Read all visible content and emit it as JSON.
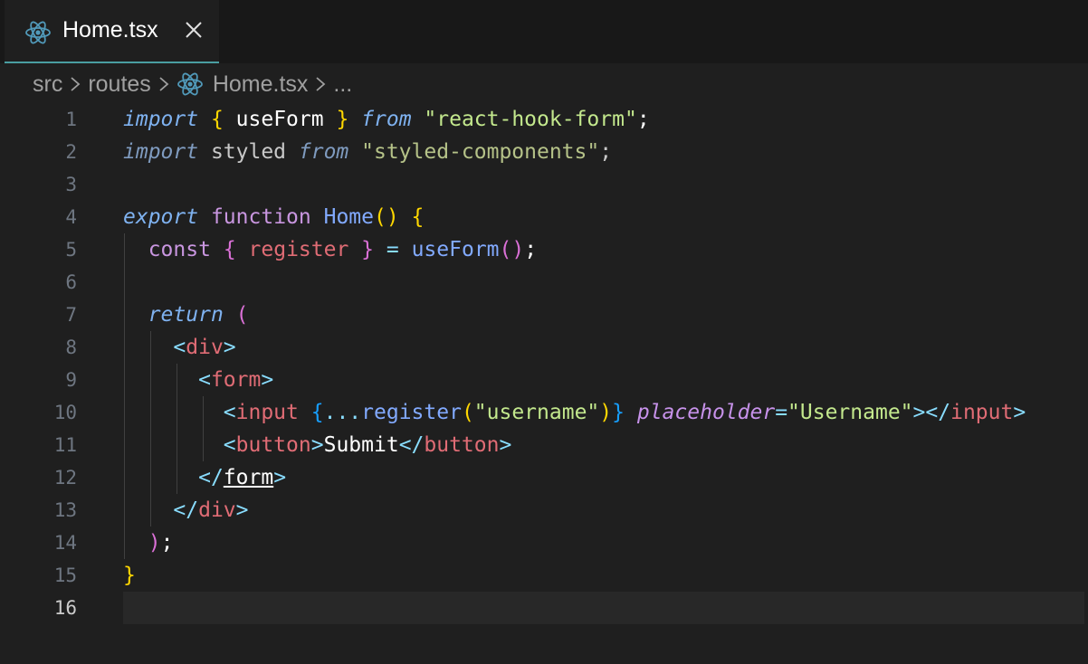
{
  "tab": {
    "title": "Home.tsx"
  },
  "breadcrumb": {
    "items": [
      "src",
      "routes",
      "Home.tsx",
      "..."
    ]
  },
  "editor": {
    "active_line": 16,
    "line_numbers": [
      "1",
      "2",
      "3",
      "4",
      "5",
      "6",
      "7",
      "8",
      "9",
      "10",
      "11",
      "12",
      "13",
      "14",
      "15",
      "16"
    ],
    "tokens": {
      "l1": [
        "import",
        " ",
        "{",
        " useForm ",
        "}",
        " ",
        "from",
        " ",
        "\"react-hook-form\"",
        ";"
      ],
      "l2": [
        "import",
        " styled ",
        "from",
        " ",
        "\"styled-components\"",
        ";"
      ],
      "l4": [
        "export",
        " ",
        "function",
        " ",
        "Home",
        "()",
        " ",
        "{"
      ],
      "l5": [
        "  ",
        "const",
        " ",
        "{",
        " ",
        "register",
        " ",
        "}",
        " = ",
        "useForm",
        "()",
        ";"
      ],
      "l7": [
        "  ",
        "return",
        " ",
        "("
      ],
      "l8": [
        "    ",
        "<",
        "div",
        ">"
      ],
      "l9": [
        "      ",
        "<",
        "form",
        ">"
      ],
      "l10": [
        "        ",
        "<",
        "input",
        " ",
        "{",
        "...",
        "register",
        "(",
        "\"username\"",
        ")",
        "}",
        " ",
        "placeholder",
        "=",
        "\"Username\"",
        ">",
        "</",
        "input",
        ">"
      ],
      "l11": [
        "        ",
        "<",
        "button",
        ">",
        "Submit",
        "</",
        "button",
        ">"
      ],
      "l12": [
        "      ",
        "</",
        "form",
        ">"
      ],
      "l13": [
        "    ",
        "</",
        "div",
        ">"
      ],
      "l14": [
        "  ",
        ")",
        ";"
      ],
      "l15": [
        "}"
      ]
    }
  },
  "icons": {
    "file_icon": "react-icon",
    "close": "close-icon",
    "separator": "chevron-right-icon"
  },
  "colors": {
    "react": "#519aba",
    "accent_tab_underline": "#4a9ea1"
  }
}
